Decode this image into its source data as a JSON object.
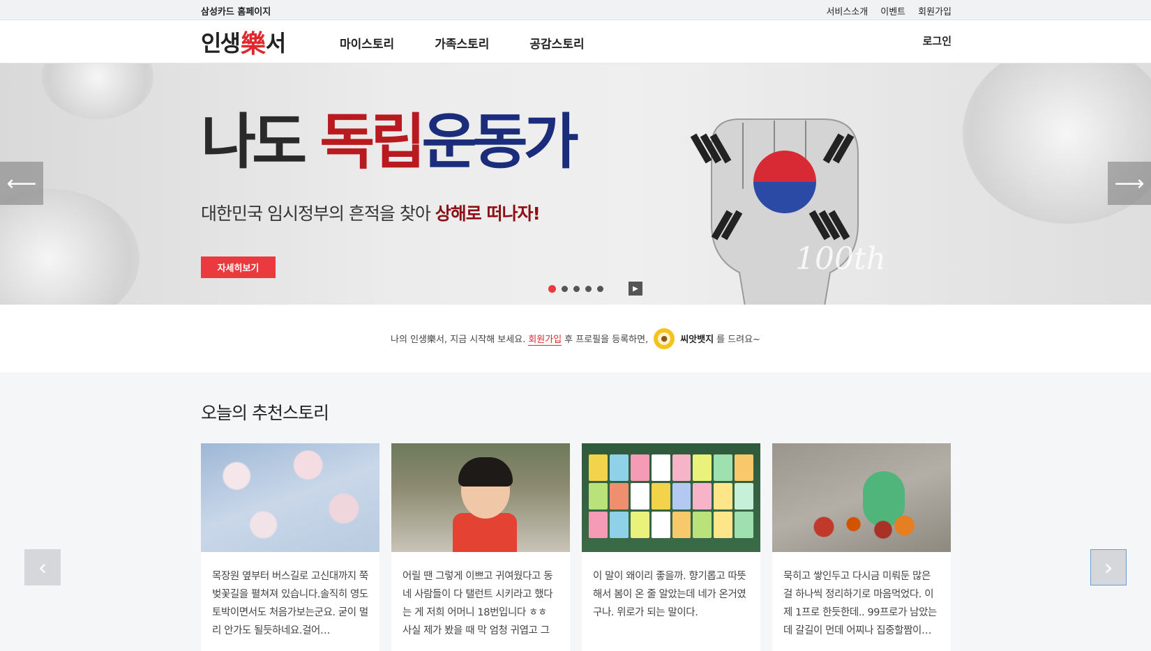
{
  "topbar": {
    "home_link": "삼성카드 홈페이지",
    "links": [
      "서비스소개",
      "이벤트",
      "회원가입"
    ]
  },
  "header": {
    "logo": {
      "part1": "인생",
      "part2": "樂",
      "part3": "서"
    },
    "menu": [
      "마이스토리",
      "가족스토리",
      "공감스토리"
    ],
    "login": "로그인"
  },
  "hero": {
    "title_part1": "나도 ",
    "title_part2": "독립",
    "title_part3": "운동가",
    "subtitle_prefix": "대한민국 임시정부의 흔적을 찾아 ",
    "subtitle_emphasis": "상해로 떠나자!",
    "cta": "자세히보기",
    "anniversary": "100th",
    "arrow_left": "⟵",
    "arrow_right": "⟶",
    "slide_count": 5,
    "active_slide": 1,
    "play_icon": "▶"
  },
  "notice": {
    "part1": "나의 인생樂서, 지금 시작해 보세요.",
    "join_link": "회원가입",
    "part2": "후 프로필을 등록하면,",
    "badge_name": "씨앗뱃지",
    "part3": "를 드려요~",
    "badge_icon_glyph": "●"
  },
  "stories": {
    "heading": "오늘의 추천스토리",
    "prev_icon": "‹",
    "next_icon": "›",
    "cards": [
      {
        "text": "목장원 옆부터 버스길로 고신대까지 쭉 벚꽃길을 펼쳐져 있습니다.솔직히 영도 토박이면서도 처음가보는군요. 굳이 멀리 안가도 될듯하네요.걸어…"
      },
      {
        "text": "어릴 땐 그렇게 이쁘고 귀여웠다고 동네 사람들이 다 탤런트 시키라고 했다는 게 저희 어머니 18번입니다 ㅎㅎ 사실 제가 봤을 때 막 엄청 귀엽고 그런…"
      },
      {
        "text": "이 말이 왜이리 좋을까. 향기롭고 따뜻해서 봄이 온 줄 알았는데 네가 온거였구나. 위로가 되는 말이다."
      },
      {
        "text": "묵히고 쌓인두고 다시금 미뤄둔 많은 걸 하나씩 정리하기로 마음먹었다. 이제 1프로 한듯한데.. 99프로가 남았는데 갈길이 먼데 어찌나 집중할짬이…"
      }
    ]
  },
  "colors": {
    "accent_red": "#ea3a40",
    "title_navy": "#1a2c7a",
    "title_red": "#b81a1f"
  }
}
